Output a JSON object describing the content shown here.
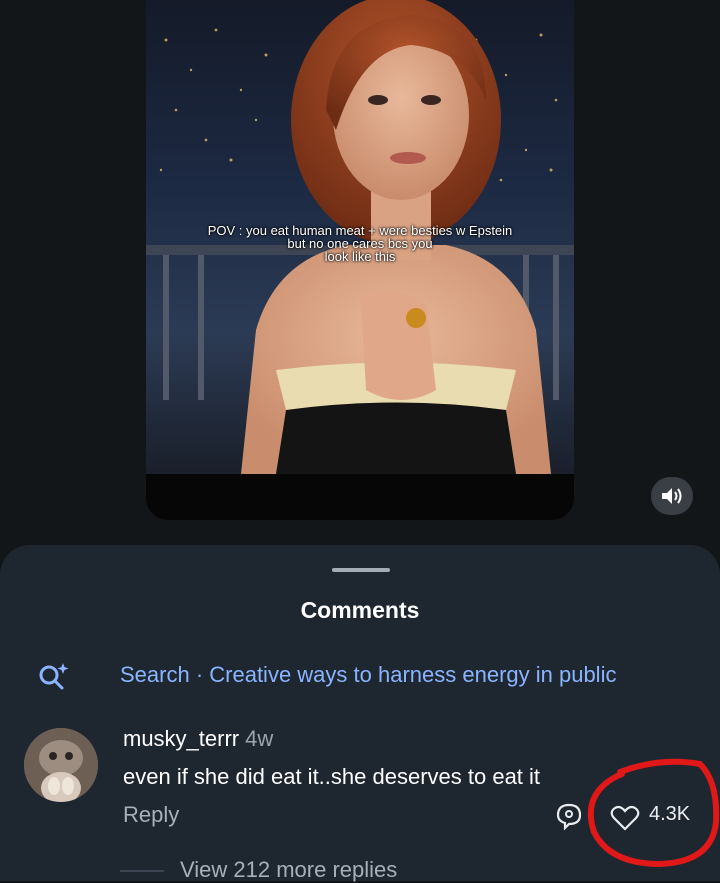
{
  "video": {
    "caption_lines": [
      "POV : you eat human meat + were besties w Epstein",
      "but no one cares bcs you",
      "look like this"
    ],
    "volume_icon": "volume-icon"
  },
  "comments_sheet": {
    "title": "Comments",
    "search": {
      "icon": "search-sparkle-icon",
      "text": "Search · Creative ways to harness energy in public"
    },
    "comment": {
      "username": "musky_terrr",
      "timestamp": "4w",
      "text": "even if she did eat it..she deserves to eat it",
      "reply_label": "Reply",
      "like_count": "4.3K",
      "view_replies": "View 212 more replies"
    }
  },
  "annotation": {
    "color": "#e01818"
  },
  "colors": {
    "accent": "#8ab4ff",
    "sheet_bg": "#1e2630"
  }
}
